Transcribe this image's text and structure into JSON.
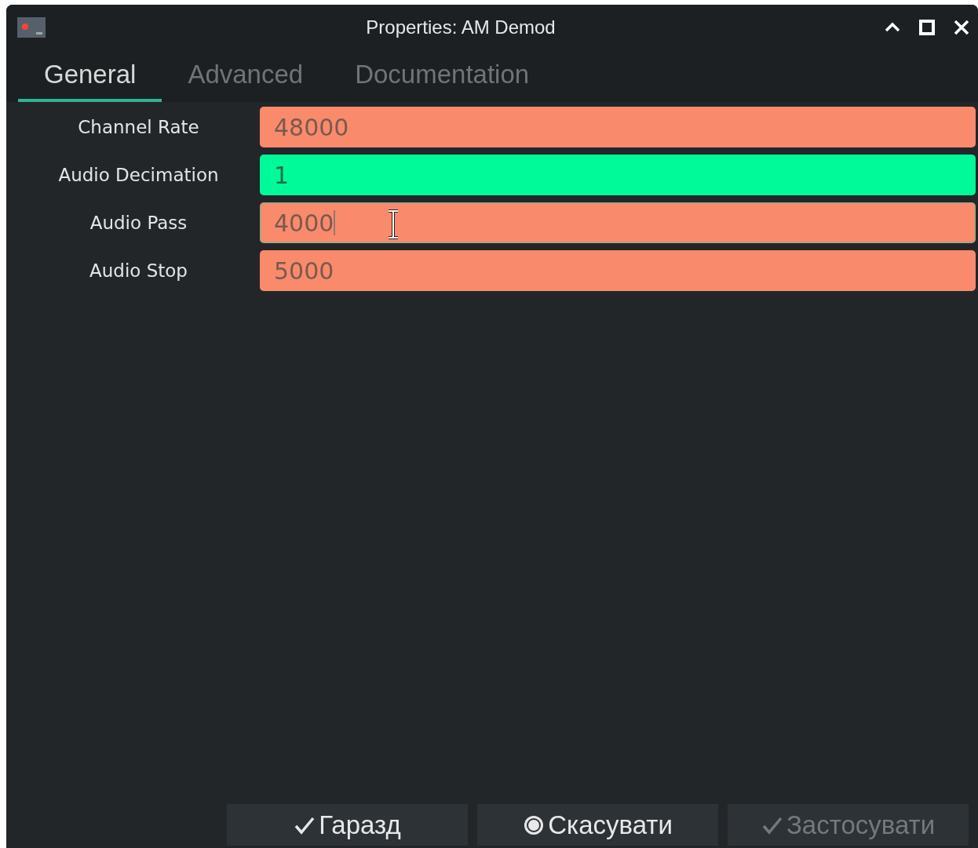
{
  "window": {
    "title": "Properties: AM Demod"
  },
  "tabs": [
    {
      "label": "General",
      "selected": true
    },
    {
      "label": "Advanced",
      "selected": false
    },
    {
      "label": "Documentation",
      "selected": false
    }
  ],
  "fields": [
    {
      "label": "Channel Rate",
      "value": "48000",
      "color": "#fa8a6c",
      "focused": false
    },
    {
      "label": "Audio Decimation",
      "value": "1",
      "color": "#00fa9a",
      "focused": false
    },
    {
      "label": "Audio Pass",
      "value": "4000",
      "color": "#fa8a6c",
      "focused": true
    },
    {
      "label": "Audio Stop",
      "value": "5000",
      "color": "#fa8a6c",
      "focused": false
    }
  ],
  "buttons": [
    {
      "label": "Гаразд",
      "kind": "confirm",
      "disabled": false
    },
    {
      "label": "Скасувати",
      "kind": "cancel",
      "disabled": false
    },
    {
      "label": "Застосувати",
      "kind": "confirm",
      "disabled": true
    }
  ]
}
